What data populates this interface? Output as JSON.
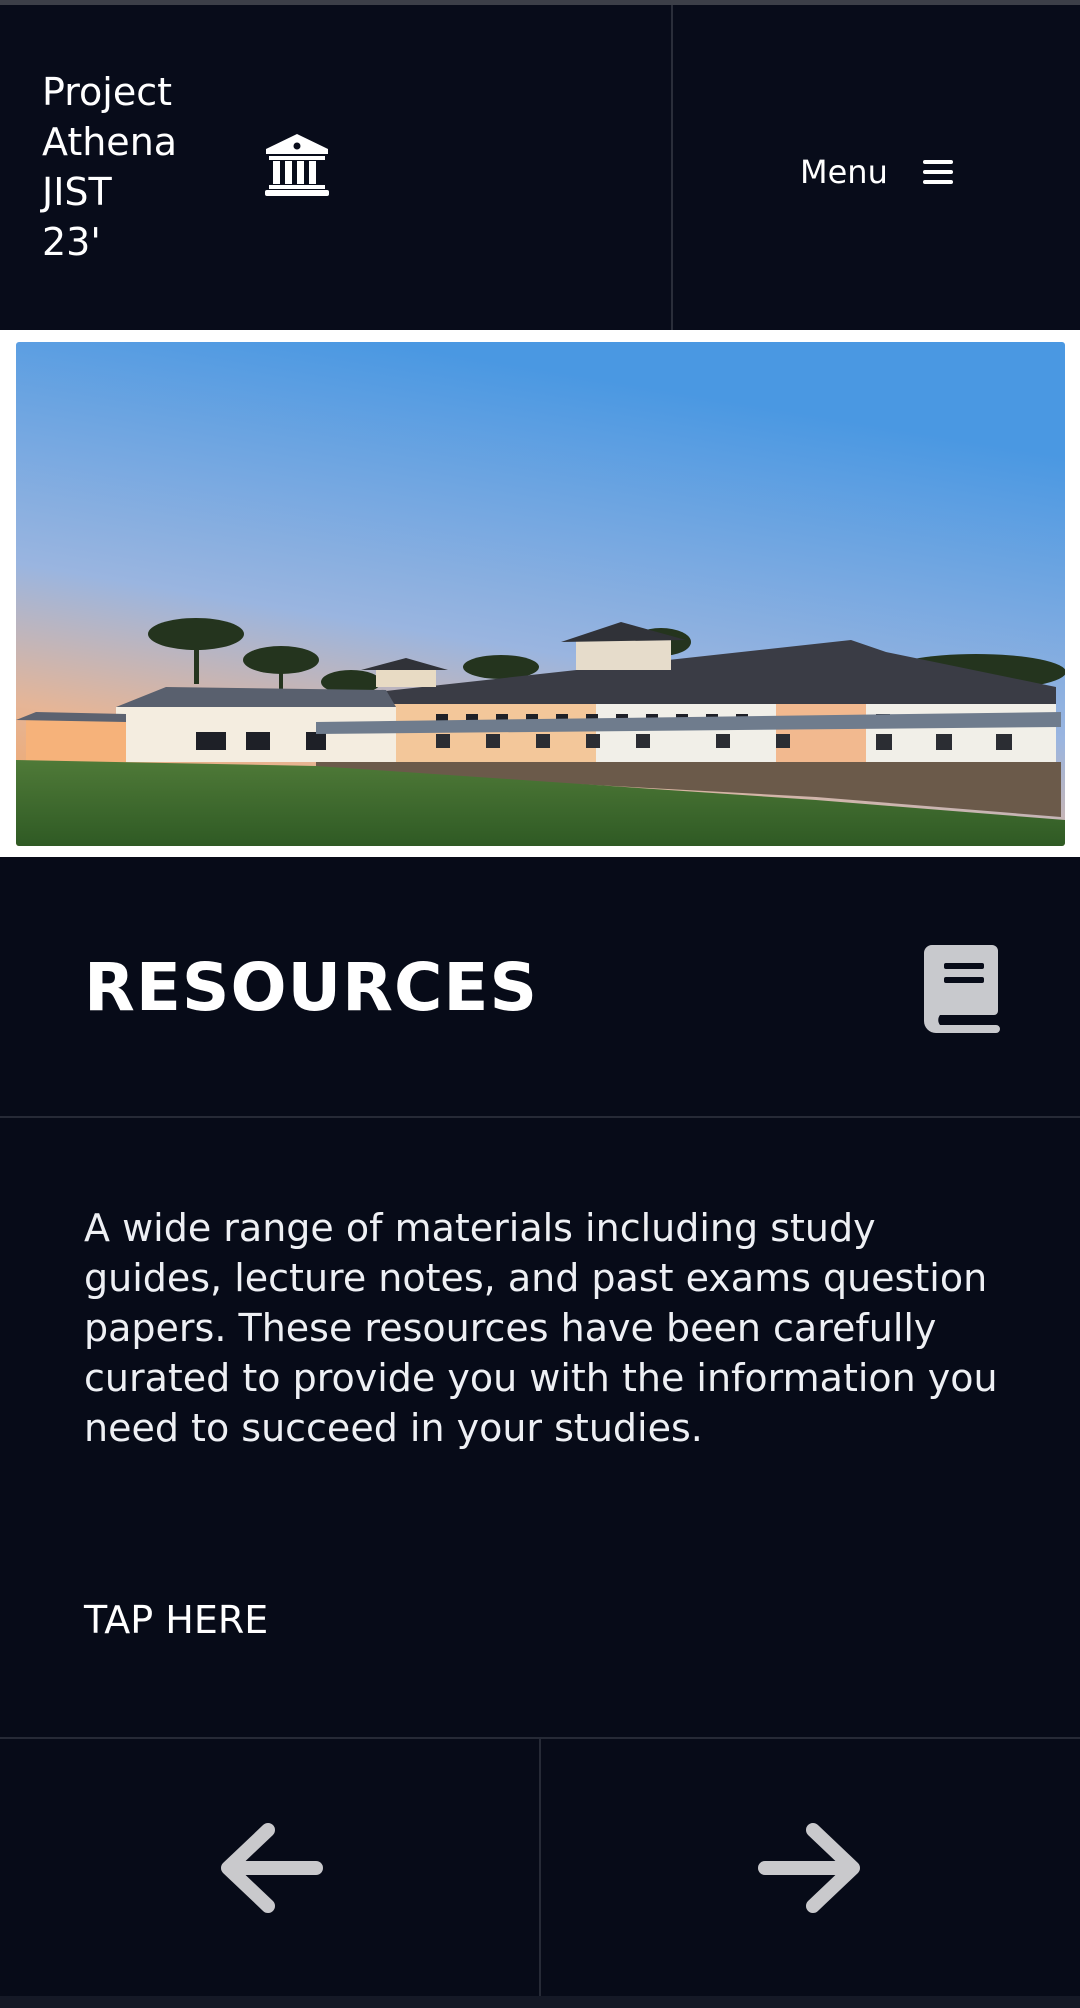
{
  "header": {
    "brand_lines": [
      "Project",
      "Athena",
      "JIST",
      "23'"
    ],
    "brand_icon": "bank-icon",
    "menu_label": "Menu",
    "menu_icon": "hamburger-icon"
  },
  "hero": {
    "image_subject": "campus building at sunset"
  },
  "section": {
    "title": "RESOURCES",
    "icon": "book-icon",
    "description": "A wide range of materials including study guides, lecture notes, and past exams question papers. These resources have been carefully curated to provide you with the information you need to succeed in your studies.",
    "link_label": "TAP HERE"
  },
  "nav": {
    "prev_icon": "arrow-left-icon",
    "next_icon": "arrow-right-icon"
  },
  "colors": {
    "background": "#070b18",
    "divider": "#262a36",
    "text": "#ffffff",
    "arrow": "#c9c9cc"
  }
}
